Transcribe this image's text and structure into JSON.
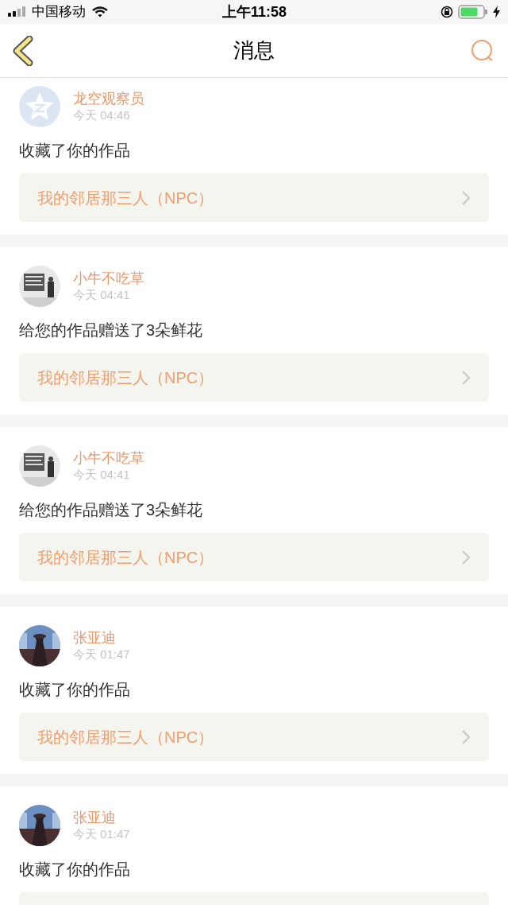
{
  "status_bar": {
    "carrier": "中国移动",
    "time": "上午11:58"
  },
  "header": {
    "title": "消息"
  },
  "messages": [
    {
      "kind": "default",
      "name": "龙空观察员",
      "time": "今天 04:46",
      "text": "收藏了你的作品",
      "work": "我的邻居那三人（NPC）"
    },
    {
      "name": "小牛不吃草",
      "time": "今天 04:41",
      "text": "给您的作品赠送了3朵鲜花",
      "work": "我的邻居那三人（NPC）"
    },
    {
      "name": "小牛不吃草",
      "time": "今天 04:41",
      "text": "给您的作品赠送了3朵鲜花",
      "work": "我的邻居那三人（NPC）"
    },
    {
      "name": "张亚迪",
      "time": "今天 01:47",
      "text": "收藏了你的作品",
      "work": "我的邻居那三人（NPC）"
    },
    {
      "name": "张亚迪",
      "time": "今天 01:47",
      "text": "收藏了你的作品"
    }
  ]
}
